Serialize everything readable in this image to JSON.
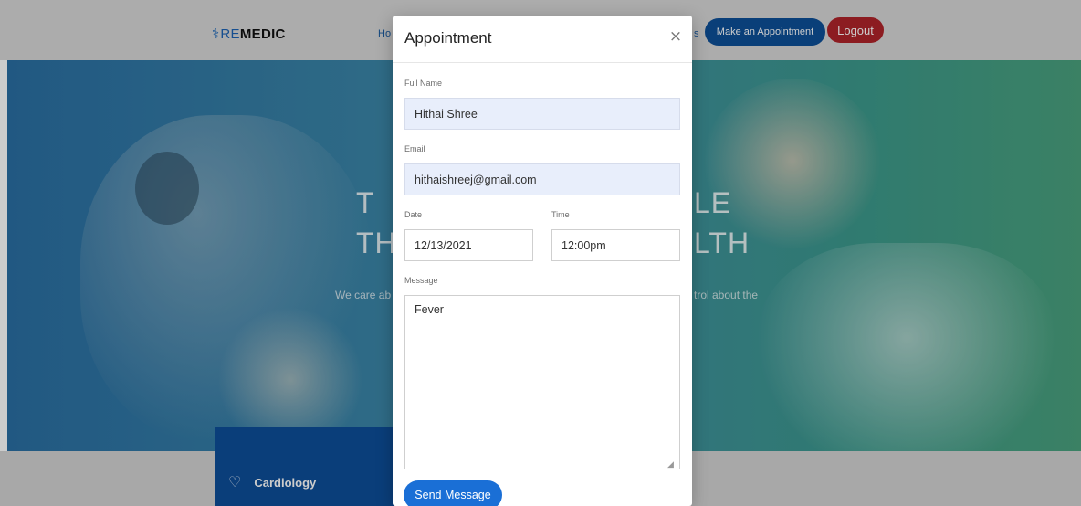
{
  "navbar": {
    "logo_re": "RE",
    "logo_medic": "MEDIC",
    "nav_home_partial": "Ho",
    "nav_partial_right": "s",
    "make_appointment": "Make an Appointment",
    "logout": "Logout"
  },
  "hero": {
    "title_left_line1": "T",
    "title_left_line2": "TH",
    "title_right_line1": "LE",
    "title_right_line2": "LTH",
    "subtitle_left": "We care ab",
    "subtitle_right": "trol about the"
  },
  "services": {
    "item_label": "Cardiology"
  },
  "modal": {
    "title": "Appointment",
    "close_glyph": "×",
    "full_name_label": "Full Name",
    "full_name_value": "Hithai Shree",
    "email_label": "Email",
    "email_value": "hithaishreej@gmail.com",
    "date_label": "Date",
    "date_value": "12/13/2021",
    "time_label": "Time",
    "time_value": "12:00pm",
    "message_label": "Message",
    "message_value": "Fever",
    "send_label": "Send Message"
  },
  "colors": {
    "primary": "#0d4f98",
    "logout": "#b0232a",
    "send": "#1a6fd6",
    "filled_input": "#e8eefb"
  },
  "icons": {
    "logo": "caduceus-icon",
    "close": "close-icon",
    "service": "heart-pulse-icon",
    "resize": "resize-handle-icon"
  }
}
